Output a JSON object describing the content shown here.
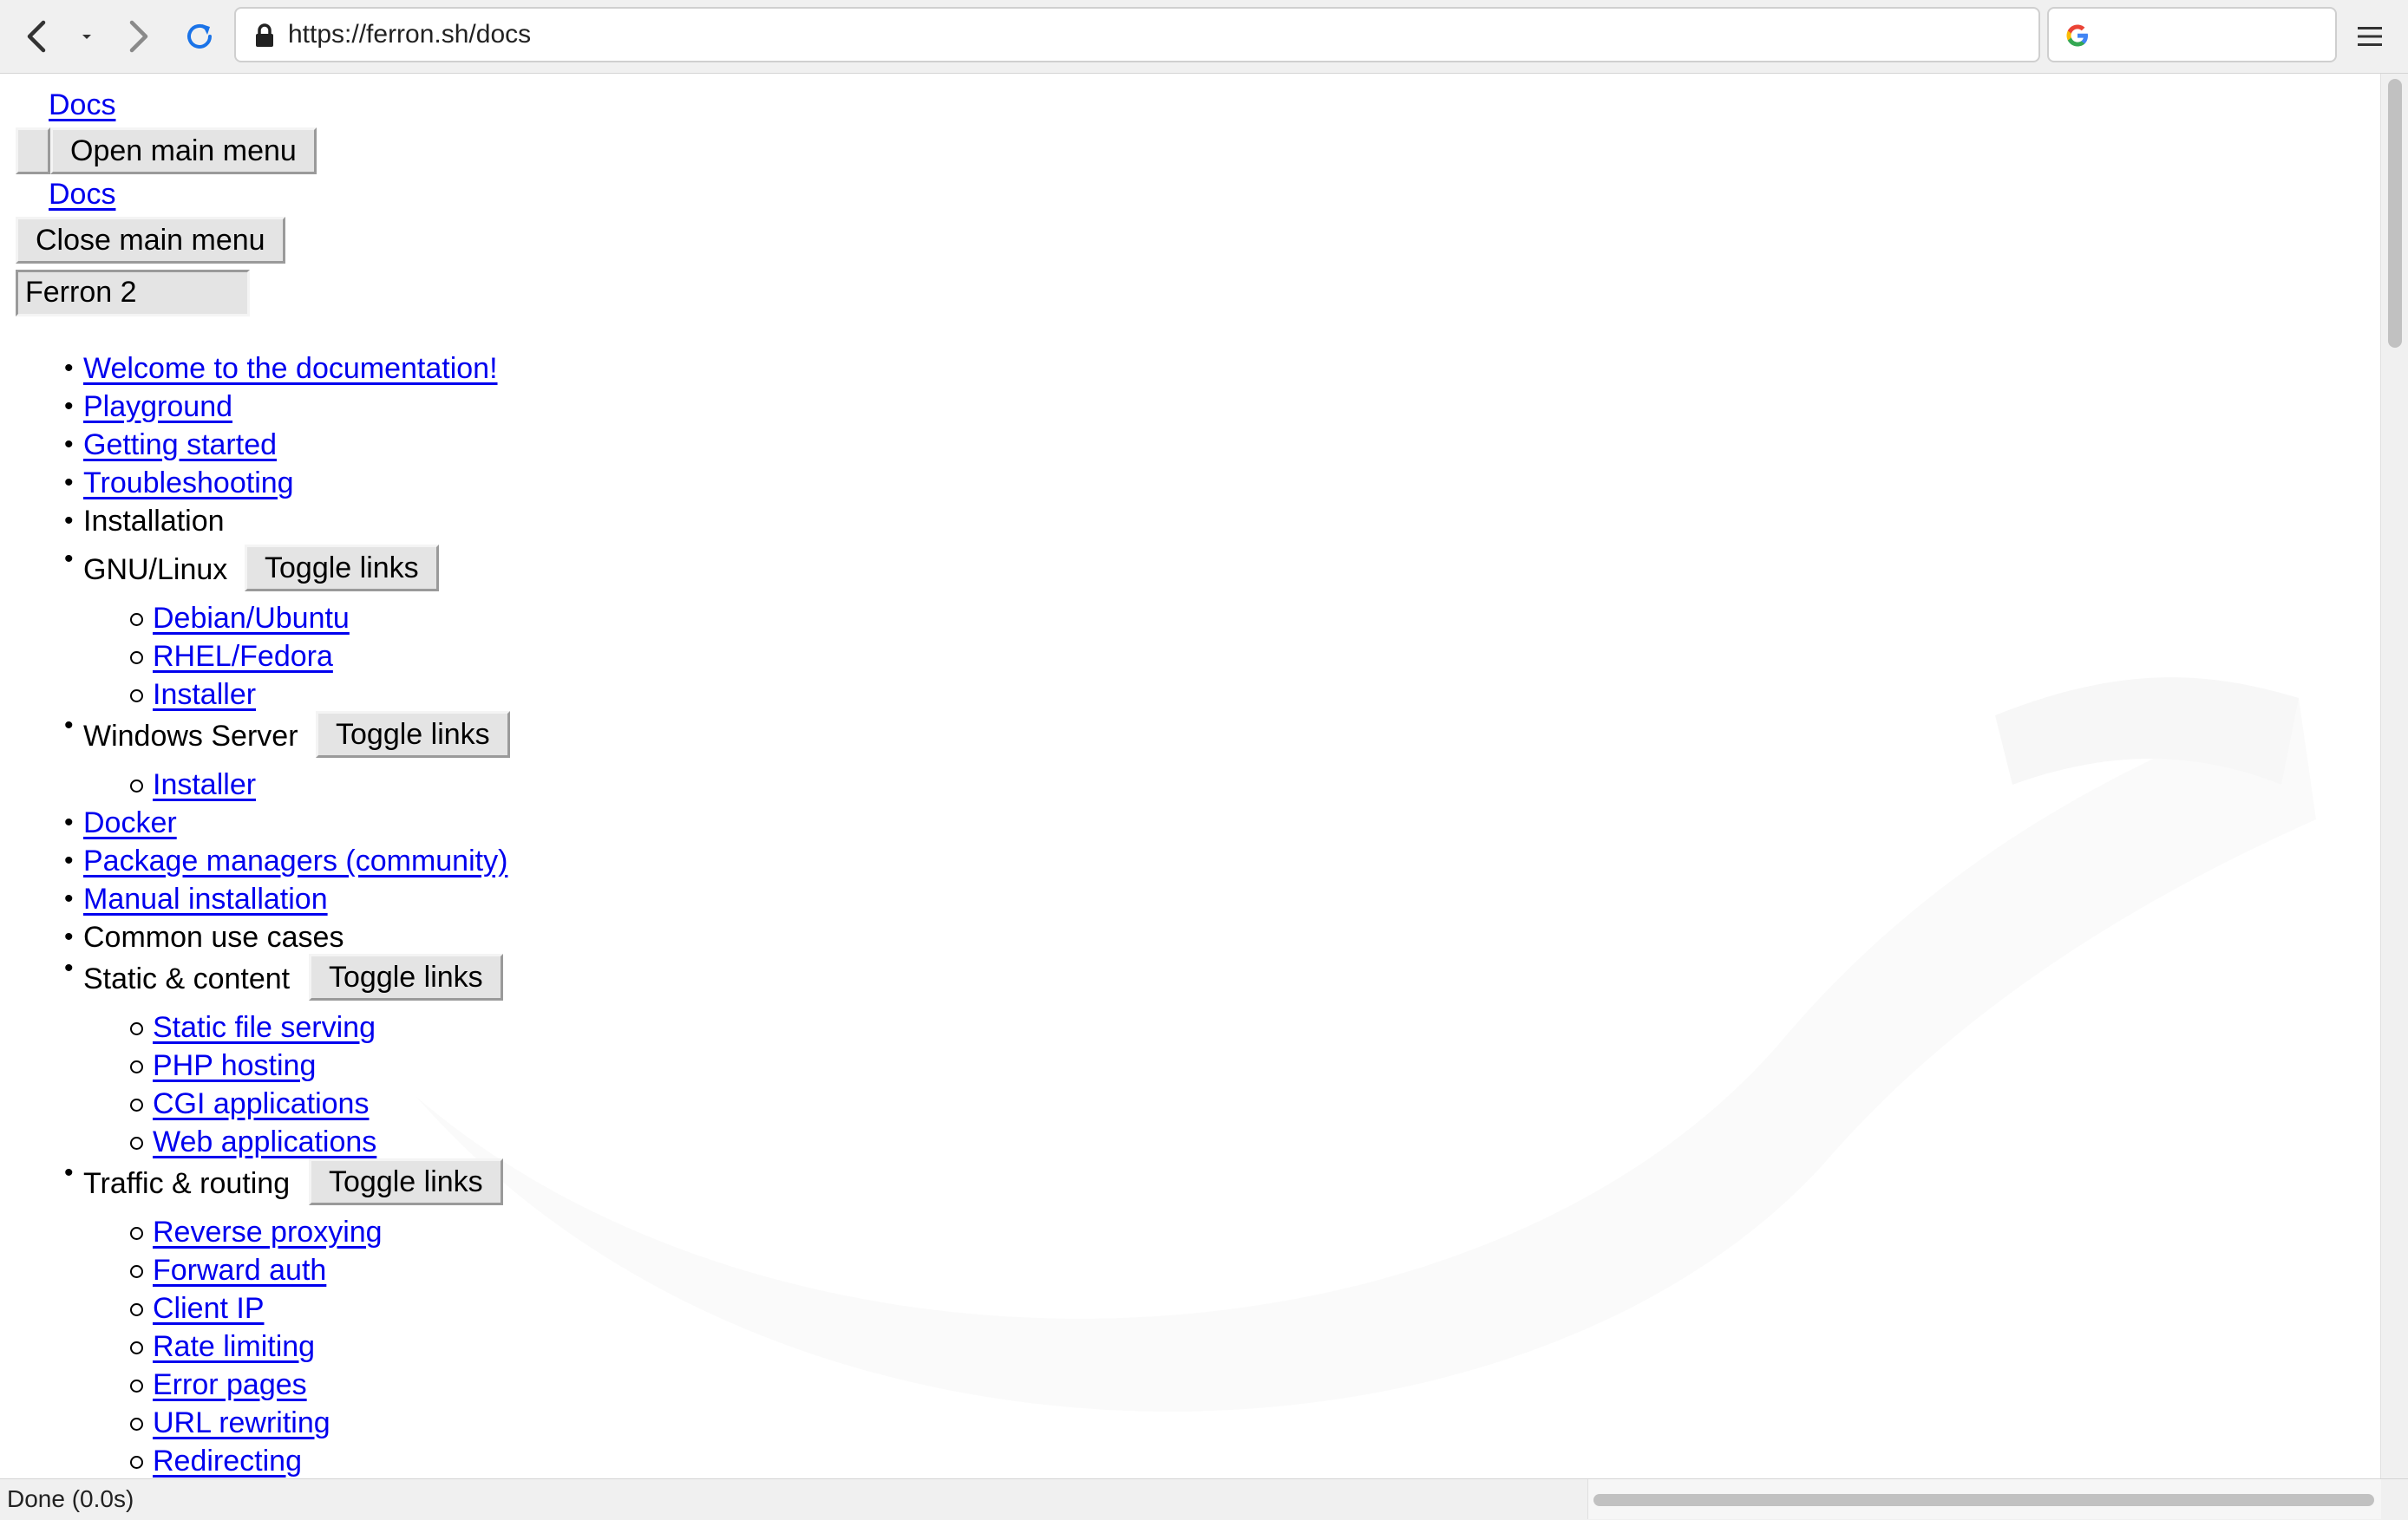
{
  "browser": {
    "url": "https://ferron.sh/docs",
    "icons": {
      "back": "back-arrow-icon",
      "history": "history-dropdown-icon",
      "forward": "forward-arrow-icon",
      "reload": "reload-icon",
      "lock": "lock-icon",
      "search_engine": "google-icon",
      "menu": "hamburger-menu-icon"
    }
  },
  "page": {
    "header": {
      "logo_link_1": "Docs",
      "open_menu_label": "Open main menu",
      "logo_link_2": "Docs",
      "close_menu_label": "Close main menu",
      "version_select": "Ferron 2"
    },
    "nav": {
      "welcome": "Welcome to the documentation!",
      "playground": "Playground",
      "getting_started": "Getting started",
      "troubleshooting": "Troubleshooting",
      "installation": "Installation",
      "gnu_linux": "GNU/Linux",
      "gnu_linux_toggle": "Toggle links",
      "debian_ubuntu": "Debian/Ubuntu",
      "rhel_fedora": "RHEL/Fedora",
      "linux_installer": "Installer",
      "windows_server": "Windows Server",
      "windows_toggle": "Toggle links",
      "windows_installer": "Installer",
      "docker": "Docker",
      "package_managers": "Package managers (community)",
      "manual_installation": "Manual installation",
      "common_use_cases": "Common use cases",
      "static_content": "Static & content",
      "static_toggle": "Toggle links",
      "static_file_serving": "Static file serving",
      "php_hosting": "PHP hosting",
      "cgi_applications": "CGI applications",
      "web_applications": "Web applications",
      "traffic_routing": "Traffic & routing",
      "traffic_toggle": "Toggle links",
      "reverse_proxying": "Reverse proxying",
      "forward_auth": "Forward auth",
      "client_ip": "Client IP",
      "rate_limiting": "Rate limiting",
      "error_pages": "Error pages",
      "url_rewriting": "URL rewriting",
      "redirecting": "Redirecting"
    }
  },
  "statusbar": {
    "status": "Done (0.0s)"
  },
  "colors": {
    "link": "#0000ee",
    "chrome": "#f0f0f0",
    "reload_blue": "#1a73e8"
  }
}
